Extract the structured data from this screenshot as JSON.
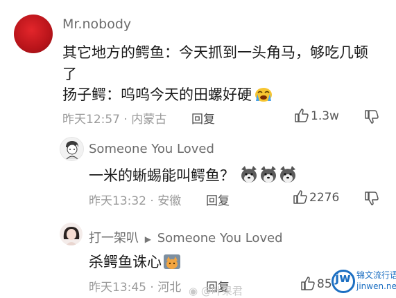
{
  "comments": [
    {
      "username": "Mr.nobody",
      "line1": "其它地方的鳄鱼：今天抓到一头角马，够吃几顿",
      "line2": "了",
      "line3": "扬子鳄：呜呜今天的田螺好硬",
      "time": "昨天12:57",
      "location": "内蒙古",
      "reply_label": "回复",
      "likes": "1.3w"
    },
    {
      "username": "Someone You Loved",
      "text": "一米的蜥蜴能叫鳄鱼？",
      "time": "昨天13:32",
      "location": "安徽",
      "reply_label": "回复",
      "likes": "2276"
    },
    {
      "username": "打一架叭",
      "reply_to": "Someone You Loved",
      "text": "杀鳄鱼诛心",
      "time": "昨天13:45",
      "location": "河北",
      "reply_label": "回复",
      "likes": "85"
    }
  ],
  "separator": "·",
  "watermark": {
    "weibo_text": "@叶果君",
    "logo_letters": "jw",
    "site_name": "锦文流行语",
    "site_url": "jinwen.net"
  },
  "colors": {
    "text": "#1a1a1a",
    "meta": "#9a9a9a",
    "avatar1": "#c8151b",
    "logo_blue": "#1c6fc2"
  },
  "icons": [
    "thumb-up-icon",
    "thumb-down-icon",
    "crying-emoji-icon",
    "dog-emoji-icon",
    "cat-emoji-icon"
  ]
}
